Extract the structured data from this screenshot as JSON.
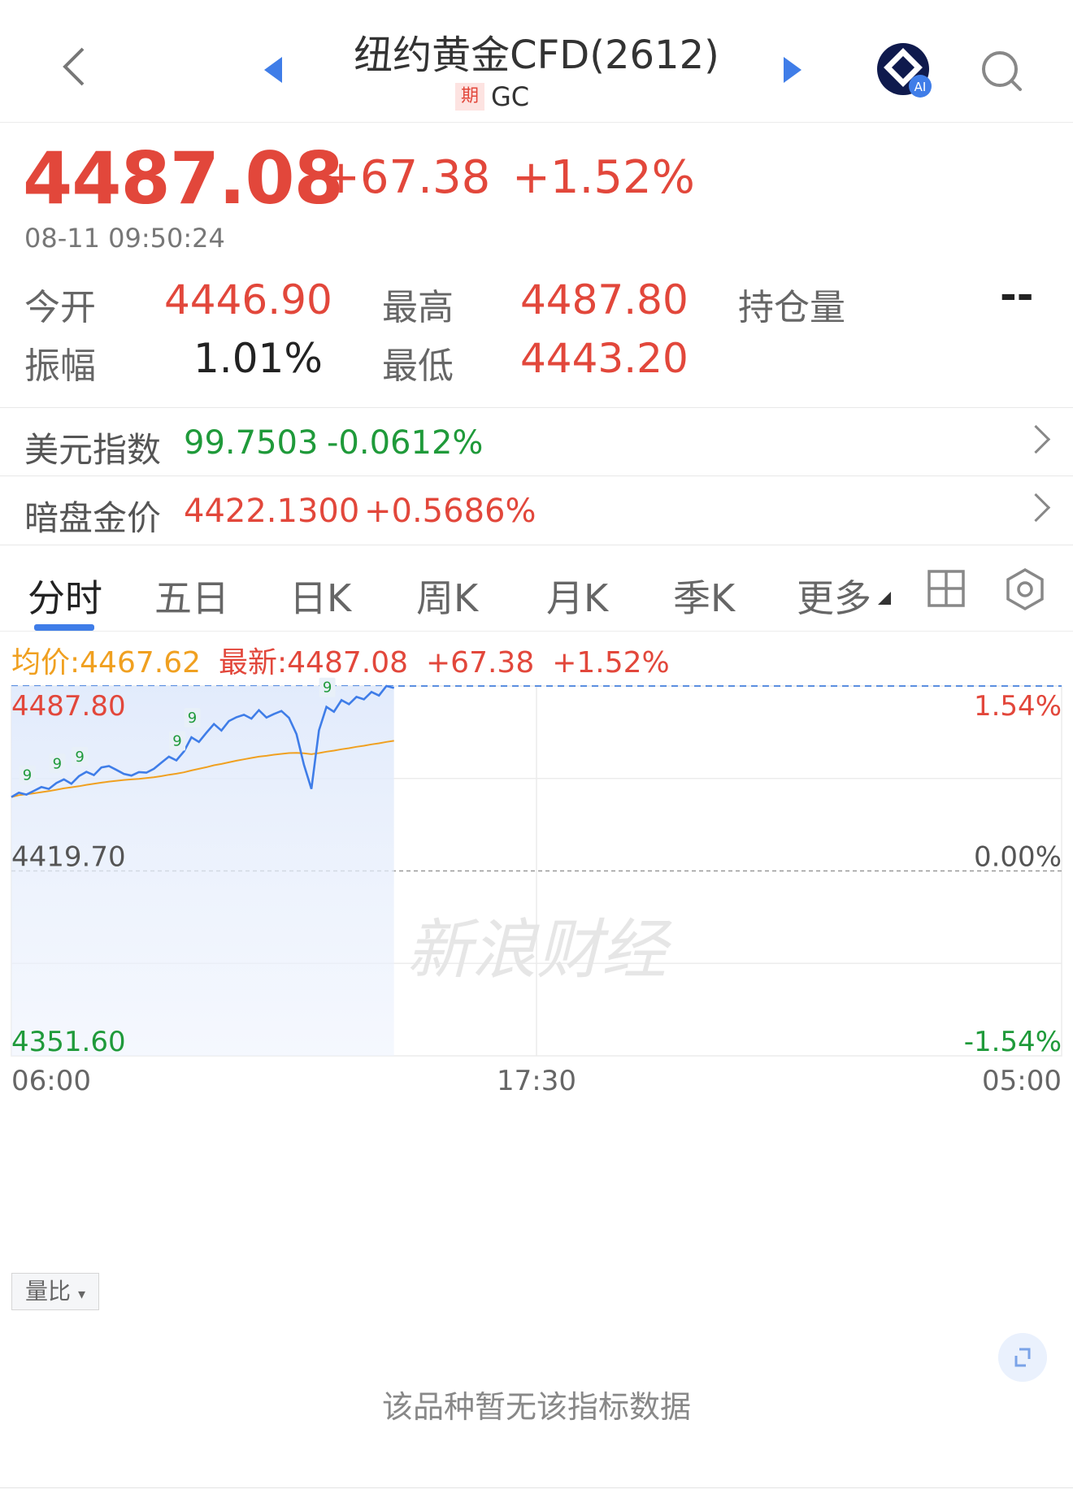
{
  "header": {
    "title": "纽约黄金CFD(2612)",
    "badge": "期",
    "code": "GC",
    "ai_label": "AI"
  },
  "quote": {
    "price": "4487.08",
    "change": "+67.38",
    "change_pct": "+1.52%",
    "time": "08-11 09:50:24",
    "open_label": "今开",
    "open": "4446.90",
    "high_label": "最高",
    "high": "4487.80",
    "position_label": "持仓量",
    "position": "--",
    "amplitude_label": "振幅",
    "amplitude": "1.01%",
    "low_label": "最低",
    "low": "4443.20"
  },
  "related": [
    {
      "label": "美元指数",
      "value": "99.7503",
      "pct": "-0.0612%"
    },
    {
      "label": "暗盘金价",
      "value": "4422.1300",
      "pct": "+0.5686%"
    }
  ],
  "tabs": [
    "分时",
    "五日",
    "日K",
    "周K",
    "月K",
    "季K",
    "更多"
  ],
  "legend": {
    "avg": "均价:4467.62",
    "latest": "最新:4487.08",
    "change": "+67.38",
    "pct": "+1.52%"
  },
  "chart_data": {
    "type": "line",
    "y_left_ticks": [
      "4487.80",
      "4419.70",
      "4351.60"
    ],
    "y_right_ticks": [
      "1.54%",
      "0.00%",
      "-1.54%"
    ],
    "x_ticks": [
      "06:00",
      "17:30",
      "05:00"
    ],
    "ylim": [
      4351.6,
      4487.8
    ],
    "prev_close": 4419.7,
    "watermark": "新浪财经",
    "marker_label": "9",
    "series": [
      {
        "name": "最新",
        "color": "#3f7de8",
        "values": [
          4446.9,
          4448.5,
          4447.8,
          4449.2,
          4450.6,
          4449.9,
          4452.1,
          4453.4,
          4451.8,
          4454.6,
          4456.2,
          4455.0,
          4457.8,
          4458.3,
          4456.9,
          4455.4,
          4454.8,
          4456.1,
          4455.9,
          4457.3,
          4459.6,
          4461.8,
          4460.4,
          4463.7,
          4468.9,
          4467.2,
          4470.6,
          4473.8,
          4471.4,
          4474.9,
          4476.3,
          4477.2,
          4475.8,
          4478.9,
          4476.2,
          4477.5,
          4478.6,
          4476.1,
          4470.1,
          4458.8,
          4449.9,
          4471.5,
          4480.1,
          4478.3,
          4482.6,
          4481.1,
          4483.8,
          4482.9,
          4485.6,
          4484.3,
          4487.8,
          4487.08
        ]
      },
      {
        "name": "均价",
        "color": "#f0a020",
        "values": [
          4446.9,
          4447.6,
          4447.9,
          4448.3,
          4448.7,
          4449.1,
          4449.6,
          4450.1,
          4450.5,
          4450.9,
          4451.4,
          4451.8,
          4452.2,
          4452.6,
          4452.9,
          4453.2,
          4453.4,
          4453.6,
          4453.9,
          4454.2,
          4454.6,
          4455.1,
          4455.5,
          4456.0,
          4456.7,
          4457.3,
          4457.9,
          4458.6,
          4459.1,
          4459.7,
          4460.3,
          4460.8,
          4461.3,
          4461.8,
          4462.1,
          4462.5,
          4462.8,
          4463.1,
          4463.2,
          4463.0,
          4462.7,
          4463.1,
          4463.6,
          4464.0,
          4464.5,
          4464.9,
          4465.4,
          4465.8,
          4466.3,
          4466.7,
          4467.2,
          4467.62
        ]
      }
    ]
  },
  "volume_ratio_label": "量比",
  "no_data_text": "该品种暂无该指标数据"
}
